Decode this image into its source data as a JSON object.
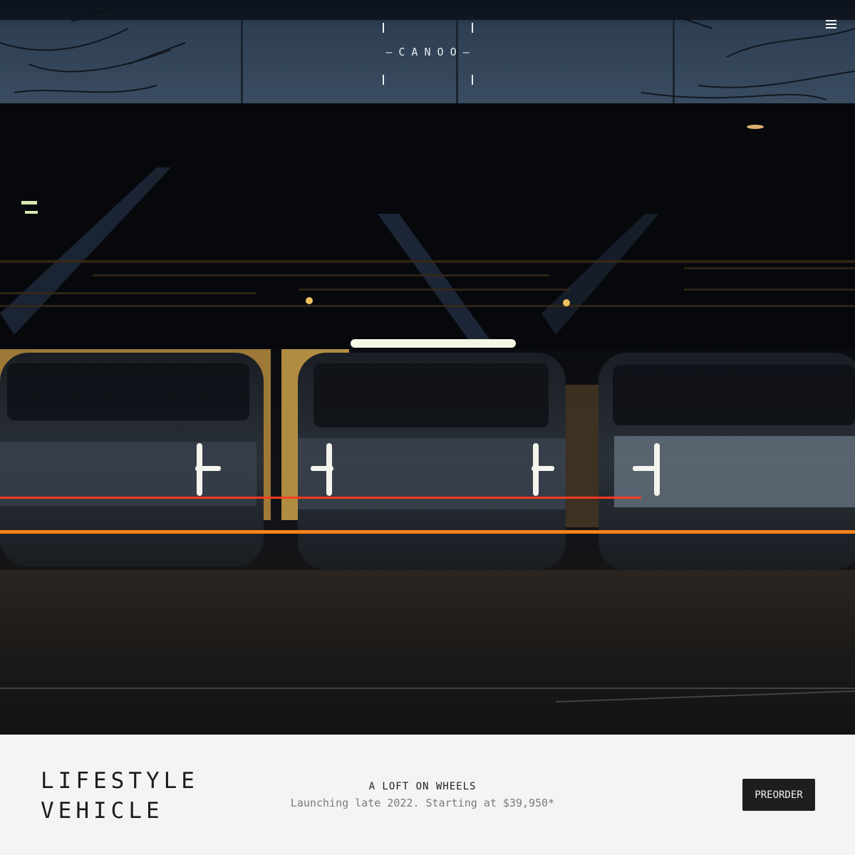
{
  "header": {
    "logo_text": "— C A N O O —",
    "menu_icon": "hamburger-menu-icon"
  },
  "hero": {
    "image_description_icon": "night-vehicles-photo"
  },
  "info_bar": {
    "title_line1": "LIFESTYLE",
    "title_line2": "VEHICLE",
    "tagline_heading": "A LOFT ON WHEELS",
    "tagline_sub": "Launching late 2022. Starting at $39,950*",
    "cta_label": "PREORDER"
  },
  "colors": {
    "cta_background": "#1e1e1e",
    "bar_background": "#f4f4f4",
    "title_text": "#1c1c1c",
    "sub_text": "#7a7a7a"
  }
}
